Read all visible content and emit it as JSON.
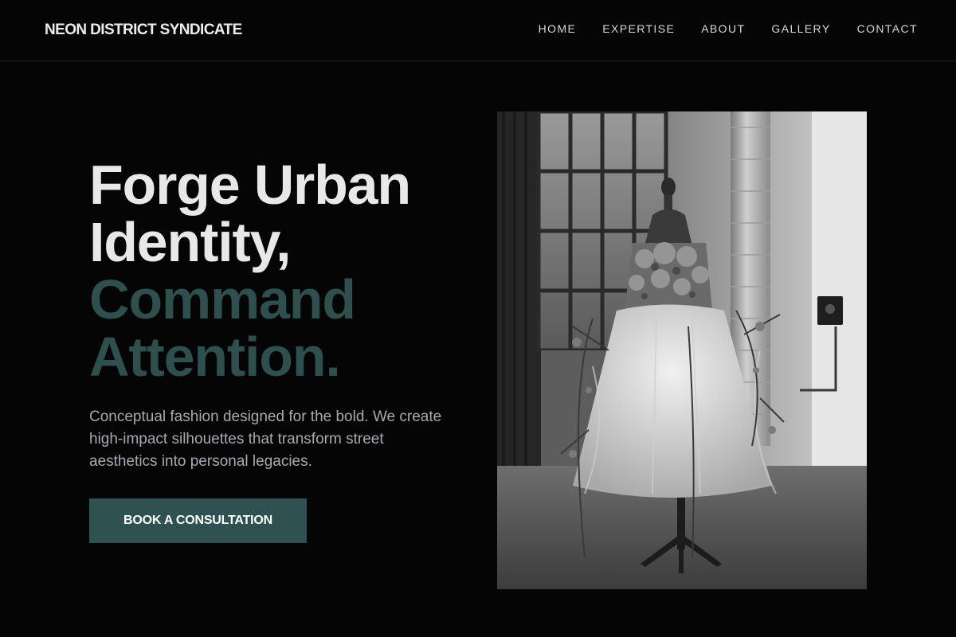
{
  "header": {
    "logo": "NEON DISTRICT SYNDICATE",
    "nav": [
      {
        "label": "HOME"
      },
      {
        "label": "EXPERTISE"
      },
      {
        "label": "ABOUT"
      },
      {
        "label": "GALLERY"
      },
      {
        "label": "CONTACT"
      }
    ]
  },
  "hero": {
    "headline_light": [
      "Forge Urban",
      "Identity,"
    ],
    "headline_accent": [
      "Command",
      "Attention."
    ],
    "subtext": "Conceptual fashion designed for the bold. We create high-impact silhouettes that transform street aesthetics into personal legacies.",
    "cta_label": "BOOK A CONSULTATION"
  },
  "colors": {
    "background": "#050505",
    "accent": "#2f5151",
    "headline_light": "#e8e8e8",
    "body_text": "#a7aab0"
  }
}
